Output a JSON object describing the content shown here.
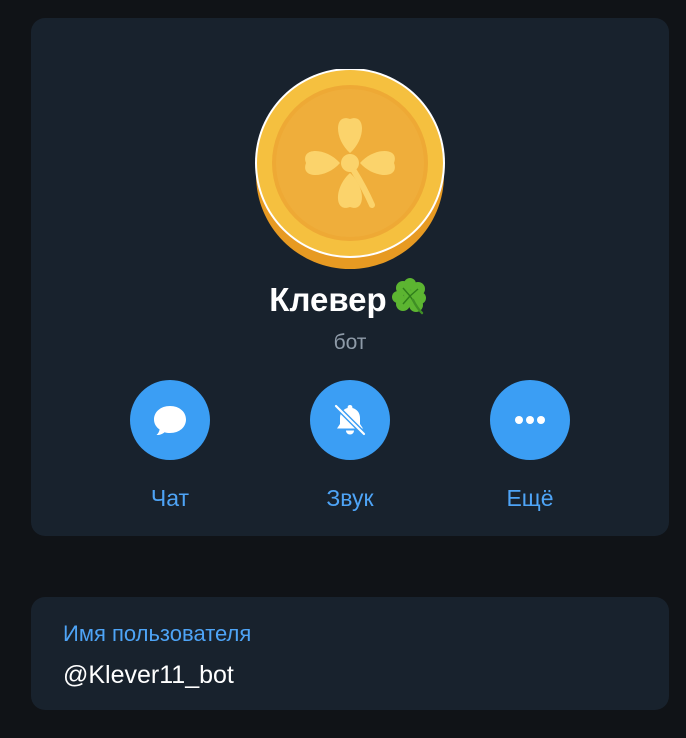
{
  "profile": {
    "name": "Клевер",
    "name_emoji": "four-leaf-clover-emoji",
    "subtitle": "бот",
    "avatar": "gold-clover-coin-avatar"
  },
  "actions": [
    {
      "label": "Чат",
      "icon": "chat-bubble-icon"
    },
    {
      "label": "Звук",
      "icon": "bell-muted-icon"
    },
    {
      "label": "Ещё",
      "icon": "more-dots-icon"
    }
  ],
  "info": {
    "label": "Имя пользователя",
    "value": "@Klever11_bot"
  },
  "colors": {
    "background": "#101317",
    "card": "#18222d",
    "accent": "#3b9ef4",
    "accent_text": "#4ea4f6",
    "subtitle": "#8e9ba8",
    "coin": "#f3b53d"
  }
}
